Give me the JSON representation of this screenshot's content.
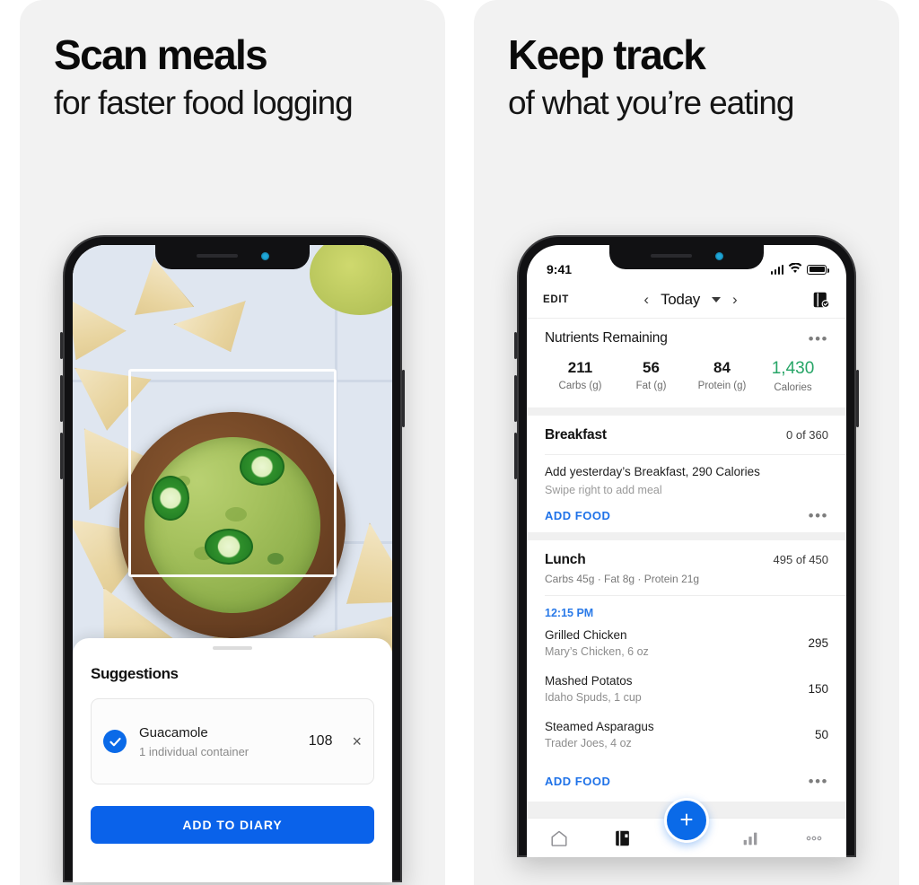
{
  "panels": [
    {
      "headline": "Scan meals",
      "subheadline": "for faster food logging"
    },
    {
      "headline": "Keep track",
      "subheadline": "of what you’re eating"
    }
  ],
  "colors": {
    "accent_blue": "#0a6ae8",
    "link_blue": "#1f72e8",
    "calories_green": "#27a567",
    "panel_bg": "#f2f2f2"
  },
  "scan_screen": {
    "scan_frame_label": "scan-frame",
    "sheet": {
      "title": "Suggestions",
      "suggestion": {
        "selected": true,
        "name": "Guacamole",
        "serving": "1 individual container",
        "calories": "108",
        "remove_label": "×"
      },
      "cta_label": "ADD TO DIARY"
    }
  },
  "diary_screen": {
    "statusbar": {
      "time": "9:41",
      "icons": [
        "signal-icon",
        "wifi-icon",
        "battery-icon"
      ]
    },
    "navbar": {
      "edit_label": "EDIT",
      "prev_label": "‹",
      "day_label": "Today",
      "next_label": "›",
      "save_icon": "diary-check-icon"
    },
    "nutrients": {
      "title": "Nutrients Remaining",
      "more_label": "•••",
      "cells": [
        {
          "value": "211",
          "label": "Carbs (g)"
        },
        {
          "value": "56",
          "label": "Fat (g)"
        },
        {
          "value": "84",
          "label": "Protein (g)"
        },
        {
          "value": "1,430",
          "label": "Calories"
        }
      ]
    },
    "breakfast": {
      "name": "Breakfast",
      "count": "0 of 360",
      "add_yesterday": "Add yesterday’s Breakfast, 290 Calories",
      "swipe_hint": "Swipe right to add meal",
      "add_food_label": "ADD FOOD",
      "more_label": "•••"
    },
    "lunch": {
      "name": "Lunch",
      "count": "495 of 450",
      "macros": "Carbs 45g  ·  Fat 8g   ·  Protein 21g",
      "time": "12:15 PM",
      "items": [
        {
          "name": "Grilled Chicken",
          "sub": "Mary’s Chicken, 6 oz",
          "calories": "295"
        },
        {
          "name": "Mashed Potatos",
          "sub": "Idaho Spuds, 1 cup",
          "calories": "150"
        },
        {
          "name": "Steamed Asparagus",
          "sub": "Trader Joes, 4 oz",
          "calories": "50"
        }
      ],
      "add_food_label": "ADD FOOD",
      "more_label": "•••"
    },
    "tabbar": {
      "items": [
        "home-icon",
        "diary-icon",
        "add-icon",
        "chart-icon",
        "more-icon"
      ],
      "fab_label": "+"
    }
  }
}
